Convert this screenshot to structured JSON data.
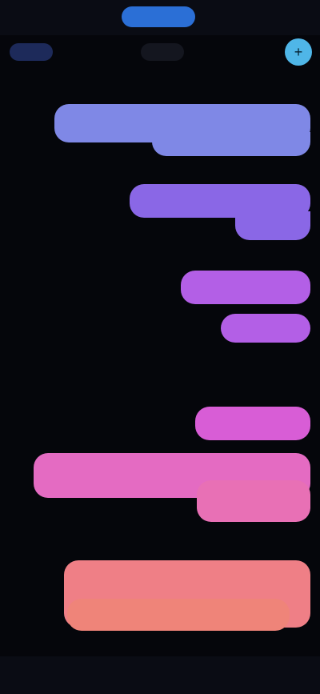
{
  "header": {
    "tabs": [
      {
        "label": ""
      },
      {
        "label": ""
      },
      {
        "label": ""
      }
    ]
  },
  "filters": {
    "pills": [
      {
        "label": ""
      },
      {
        "label": ""
      }
    ]
  },
  "timeline": {
    "groups": [
      {
        "label": ""
      },
      {
        "label": ""
      },
      {
        "label": ""
      },
      {
        "label": ""
      },
      {
        "label": ""
      }
    ],
    "messages": [
      {
        "text": ""
      },
      {
        "text": ""
      },
      {
        "text": ""
      },
      {
        "text": ""
      },
      {
        "text": ""
      }
    ]
  },
  "bottom_nav": {
    "items": [
      {
        "label": ""
      },
      {
        "label": ""
      }
    ]
  },
  "icons": {
    "fab": "add-icon"
  },
  "colors": {
    "accent": "#2b6fd6",
    "fab": "#4fb6e8",
    "bubble_1": "#7f88e6",
    "bubble_2": "#8a67e6",
    "bubble_3": "#b35fe6",
    "bubble_4": "#e46bc2",
    "bubble_5": "#ef7f86"
  }
}
